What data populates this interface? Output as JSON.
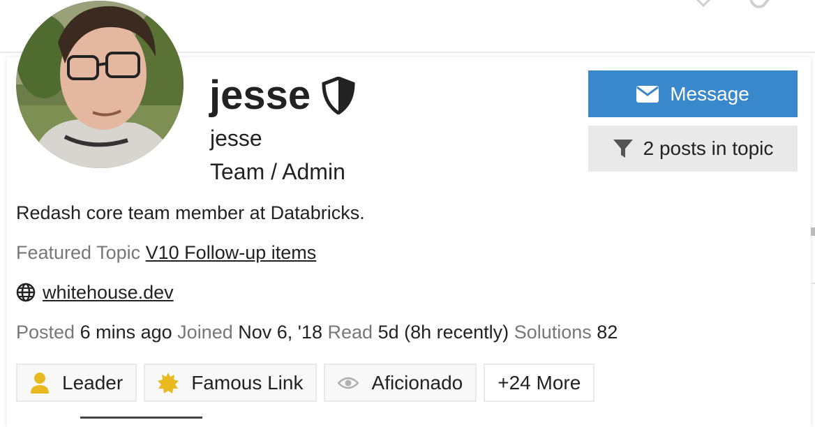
{
  "profile": {
    "username": "jesse",
    "full_name": "jesse",
    "title": "Team / Admin",
    "bio": "Redash core team member at Databricks.",
    "featured_label": "Featured Topic",
    "featured_topic": "V10 Follow-up items",
    "website": "whitehouse.dev"
  },
  "actions": {
    "message_label": "Message",
    "posts_label": "2 posts in topic"
  },
  "stats": {
    "posted_label": "Posted",
    "posted_value": "6 mins ago",
    "joined_label": "Joined",
    "joined_value": "Nov 6, '18",
    "read_label": "Read",
    "read_value": "5d (8h recently)",
    "solutions_label": "Solutions",
    "solutions_value": "82"
  },
  "badges": [
    {
      "label": "Leader",
      "icon": "user-icon",
      "color": "#e9b920"
    },
    {
      "label": "Famous Link",
      "icon": "certificate-icon",
      "color": "#e9b920"
    },
    {
      "label": "Aficionado",
      "icon": "eye-icon",
      "color": "#b0b0b0"
    },
    {
      "label": "+24 More"
    }
  ],
  "colors": {
    "accent": "#3a88cc",
    "muted_text": "#777777",
    "badge_gold": "#e9b920"
  }
}
